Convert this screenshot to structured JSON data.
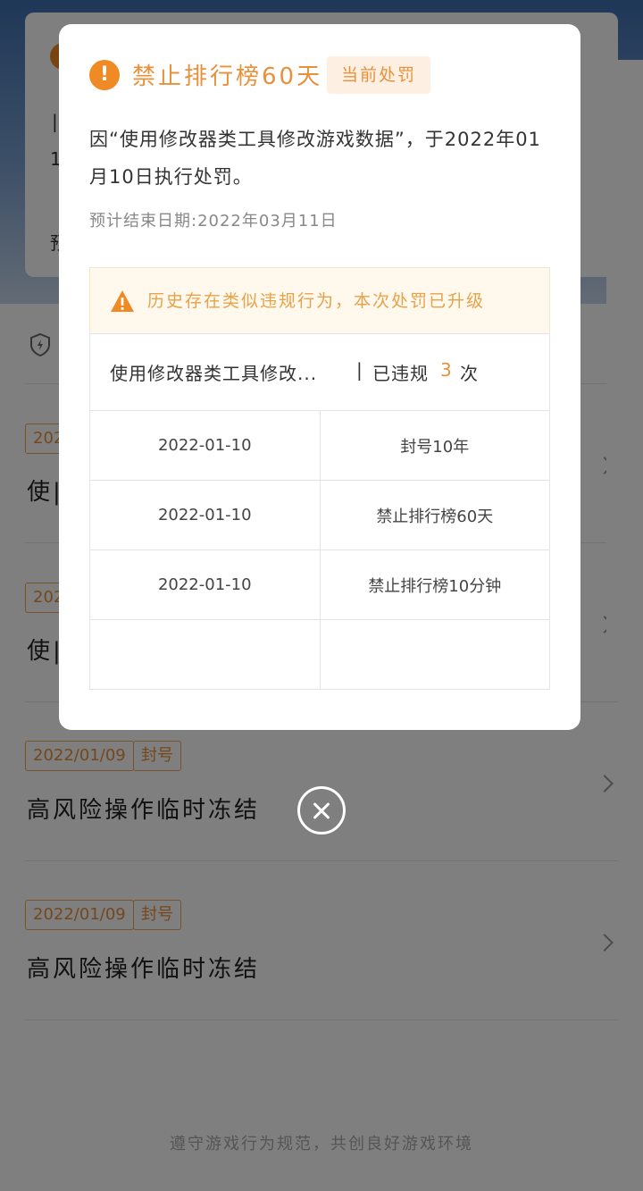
{
  "background": {
    "records": [
      {
        "date": "2022/01/09",
        "tag": "封号",
        "title": "高风险操作临时冻结"
      },
      {
        "date": "2022/01/09",
        "tag": "封号",
        "title": "高风险操作临时冻结"
      }
    ],
    "partial_records": [
      {
        "date_frag": "202",
        "title_frag": "使|"
      },
      {
        "date_frag": "202",
        "title_frag": "使|"
      }
    ],
    "card_frags": [
      "|",
      "10",
      "预"
    ],
    "footer": "遵守游戏行为规范，共创良好游戏环境"
  },
  "modal": {
    "title": "禁止排行榜60天",
    "badge": "当前处罚",
    "description": "因“使用修改器类工具修改游戏数据”，于2022年01月10日执行处罚。",
    "end_date": "预计结束日期:2022年03月11日",
    "notice": "历史存在类似违规行为，本次处罚已升级",
    "violation": {
      "item": "使用修改器类工具修改...",
      "separator": "|",
      "prefix": "已违规",
      "count": "3",
      "suffix": "次"
    },
    "history": [
      {
        "date": "2022-01-10",
        "penalty": "封号10年"
      },
      {
        "date": "2022-01-10",
        "penalty": "禁止排行榜60天"
      },
      {
        "date": "2022-01-10",
        "penalty": "禁止排行榜10分钟"
      },
      {
        "date": "",
        "penalty": ""
      }
    ]
  },
  "colors": {
    "accent": "#e8913a",
    "accent_bg": "#fdf0e2",
    "notice_bg": "#fff8ec"
  }
}
